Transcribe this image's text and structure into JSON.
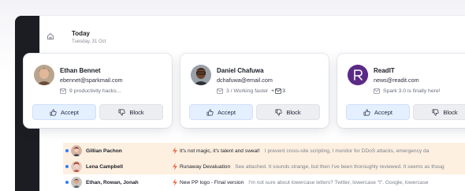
{
  "header": {
    "title": "Today",
    "date": "Tuesday, 31 Oct"
  },
  "cards": [
    {
      "name": "Ethan Bennet",
      "email": "ebennet@sparkmail.com",
      "preview": "9 productivity hacks...",
      "accept_label": "Accept",
      "block_label": "Block"
    },
    {
      "name": "Daniel Chafuwa",
      "email": "dchafuwa@email.com",
      "preview": "3 / Working faster",
      "preview_count": "3",
      "accept_label": "Accept",
      "block_label": "Block"
    },
    {
      "name": "ReadIT",
      "email": "news@readit.com",
      "preview": "Spark 3.0 is finally here!",
      "accept_label": "Accept",
      "block_label": "Block"
    }
  ],
  "emails": [
    {
      "sender": "Gillian Pachon",
      "subject": "It's not magic, it's talent and sweat!",
      "snippet": "I prevent cross-site scripting, I monitor for DDoS attacks, emergency da"
    },
    {
      "sender": "Lena Campbell",
      "subject": "Runaway Devaluation",
      "snippet": "See attached. It sounds strange, but then I've been thoroughly reviewed. It seems as thoug"
    },
    {
      "sender": "Ethan, Rowan, Jonah",
      "subject": "New PP logo - Final version",
      "snippet": "I'm not sure about lowercase letters? Twitter, lowercase \"t\". Google, lowercase"
    }
  ],
  "colors": {
    "accent": "#2f7cf6",
    "accept_bg": "#e4efff",
    "highlight_row": "#fdf0e1",
    "bolt": "#f26a4b",
    "sidebar": "#1c1d22",
    "readit_brand": "#5b2a86"
  }
}
